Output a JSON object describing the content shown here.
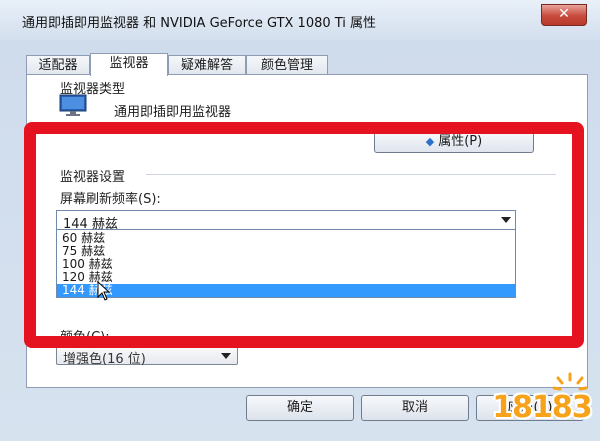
{
  "window": {
    "title": "通用即插即用监视器 和 NVIDIA GeForce GTX 1080 Ti 属性",
    "close_label": "✕"
  },
  "tabs": [
    {
      "label": "适配器",
      "active": false
    },
    {
      "label": "监视器",
      "active": true
    },
    {
      "label": "疑难解答",
      "active": false
    },
    {
      "label": "颜色管理",
      "active": false
    }
  ],
  "monitor_type": {
    "group_label": "监视器类型",
    "icon": "monitor-icon",
    "name": "通用即插即用监视器",
    "properties_button": "属性(P)",
    "properties_icon": "shield-icon"
  },
  "monitor_settings": {
    "group_label": "监视器设置",
    "refresh_label": "屏幕刷新频率(S):",
    "refresh_value": "144 赫兹",
    "refresh_options": [
      "60 赫兹",
      "75 赫兹",
      "100 赫兹",
      "120 赫兹",
      "144 赫兹"
    ],
    "selected_option_index": 4
  },
  "colors": {
    "label": "颜色(C):",
    "value": "增强色(16 位)"
  },
  "buttons": {
    "ok": "确定",
    "cancel": "取消",
    "apply": "应用(A)"
  },
  "watermark": {
    "text": "18183"
  },
  "theme": {
    "highlight": "#3399ff",
    "annotation_red": "#e5121f",
    "logo_orange": "#f7a21b"
  }
}
